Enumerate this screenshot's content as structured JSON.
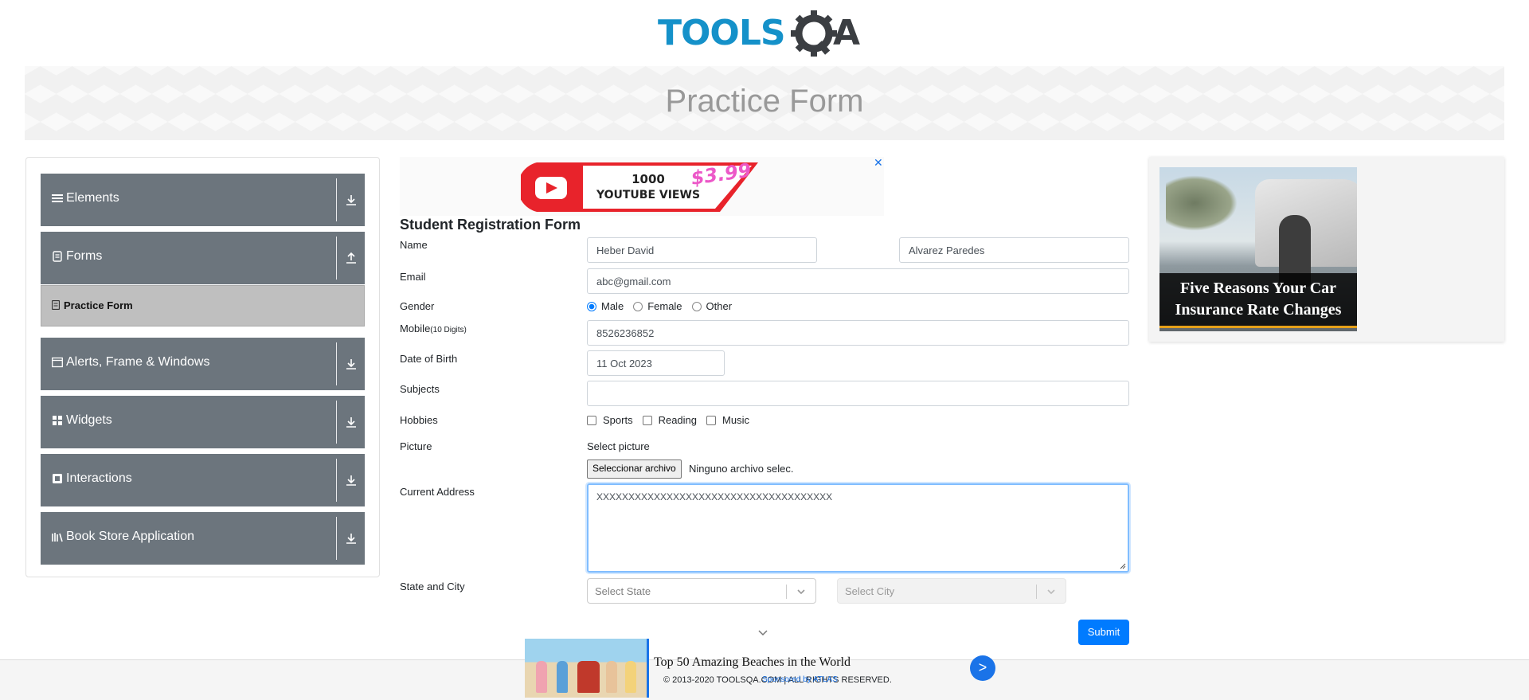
{
  "header": {
    "logo_text": "TOOLSQA"
  },
  "banner": {
    "title": "Practice Form"
  },
  "sidebar": {
    "groups": [
      {
        "label": "Elements",
        "icon": "hamburger-icon"
      },
      {
        "label": "Forms",
        "icon": "document-icon",
        "expanded": true,
        "items": [
          {
            "label": "Practice Form",
            "active": true
          }
        ]
      },
      {
        "label": "Alerts, Frame & Windows",
        "icon": "window-icon"
      },
      {
        "label": "Widgets",
        "icon": "grid-icon"
      },
      {
        "label": "Interactions",
        "icon": "interaction-icon"
      },
      {
        "label": "Book Store Application",
        "icon": "books-icon"
      }
    ]
  },
  "ad_top": {
    "line1": "1000",
    "line2": "YOUTUBE VIEWS",
    "price": "$3.99",
    "close": "✕"
  },
  "form": {
    "title": "Student Registration Form",
    "labels": {
      "name": "Name",
      "email": "Email",
      "gender": "Gender",
      "mobile": "Mobile",
      "mobile_hint": "(10 Digits)",
      "dob": "Date of Birth",
      "subjects": "Subjects",
      "hobbies": "Hobbies",
      "picture": "Picture",
      "address": "Current Address",
      "state_city": "State and City"
    },
    "first_name": "Heber David",
    "last_name": "Alvarez Paredes",
    "email": "abc@gmail.com",
    "gender_options": [
      "Male",
      "Female",
      "Other"
    ],
    "gender_selected": "Male",
    "mobile": "8526236852",
    "dob": "11 Oct 2023",
    "subjects": "",
    "hobbies": [
      "Sports",
      "Reading",
      "Music"
    ],
    "picture_label": "Select picture",
    "file_button": "Seleccionar archivo",
    "file_status": "Ninguno archivo selec.",
    "address": "XXXXXXXXXXXXXXXXXXXXXXXXXXXXXXXXXXXXX",
    "state_placeholder": "Select State",
    "city_placeholder": "Select City",
    "submit": "Submit"
  },
  "ad_right": {
    "caption_line1": "Five Reasons Your Car",
    "caption_line2": "Insurance Rate Changes"
  },
  "bottom_ad": {
    "headline": "Top 50 Amazing Beaches in the World",
    "sponsor": "Sponsored by ATLAS",
    "go": ">"
  },
  "footer": {
    "text": "© 2013-2020 TOOLSQA.COM | ALL RIGHTS RESERVED."
  },
  "colors": {
    "menu_bg": "#6c757d",
    "active_bg": "#bfbfbf",
    "primary": "#007bff",
    "logo_blue": "#1591c9",
    "logo_dark": "#3b3e42"
  }
}
